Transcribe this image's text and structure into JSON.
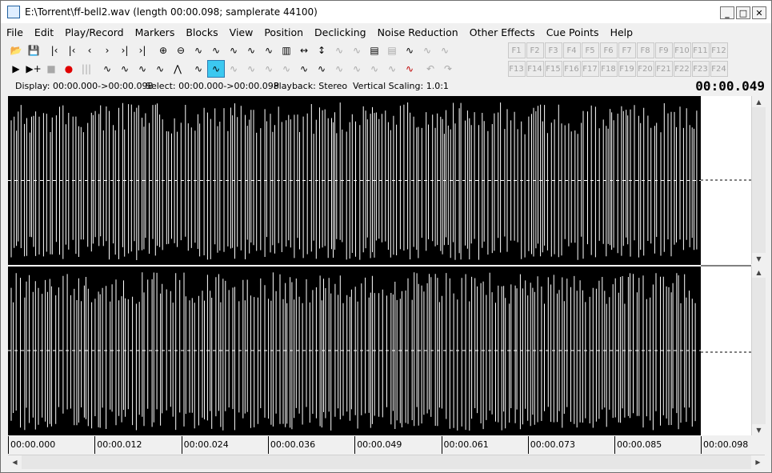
{
  "window": {
    "title": "E:\\Torrent\\ff-bell2.wav (length 00:00.098; samplerate 44100)"
  },
  "menu": [
    "File",
    "Edit",
    "Play/Record",
    "Markers",
    "Blocks",
    "View",
    "Position",
    "Declicking",
    "Noise Reduction",
    "Other Effects",
    "Cue Points",
    "Help"
  ],
  "toolbar": {
    "row1": [
      {
        "name": "open-icon",
        "glyph": "📂",
        "disabled": false
      },
      {
        "name": "save-icon",
        "glyph": "💾",
        "disabled": true
      },
      {
        "sep": true
      },
      {
        "name": "go-start-icon",
        "glyph": "|‹",
        "disabled": false
      },
      {
        "name": "marker-prev-icon",
        "glyph": "|‹",
        "disabled": false
      },
      {
        "name": "step-back-icon",
        "glyph": "‹",
        "disabled": false
      },
      {
        "name": "step-forward-icon",
        "glyph": "›",
        "disabled": false
      },
      {
        "name": "marker-next-icon",
        "glyph": "›|",
        "disabled": false
      },
      {
        "name": "go-end-icon",
        "glyph": "›|",
        "disabled": false
      },
      {
        "sep": true
      },
      {
        "name": "zoom-in-icon",
        "glyph": "⊕",
        "disabled": false
      },
      {
        "name": "zoom-out-icon",
        "glyph": "⊖",
        "disabled": false
      },
      {
        "name": "zoom-wave-icon",
        "glyph": "∿",
        "disabled": false
      },
      {
        "name": "wave-view-icon",
        "glyph": "∿",
        "disabled": false
      },
      {
        "name": "wave-marker-icon",
        "glyph": "∿",
        "disabled": false
      },
      {
        "name": "wave-edit-icon",
        "glyph": "∿",
        "disabled": false
      },
      {
        "name": "wave-peak-icon",
        "glyph": "∿",
        "disabled": false
      },
      {
        "name": "spectrum-icon",
        "glyph": "▥",
        "disabled": false
      },
      {
        "name": "horizontal-span-icon",
        "glyph": "↔",
        "disabled": false
      },
      {
        "name": "vertical-span-icon",
        "glyph": "↕",
        "disabled": false
      },
      {
        "name": "filter-a-icon",
        "glyph": "∿",
        "disabled": true
      },
      {
        "name": "filter-b-icon",
        "glyph": "∿",
        "disabled": true
      },
      {
        "name": "paste-wave-icon",
        "glyph": "▤",
        "disabled": false
      },
      {
        "name": "mix-wave-icon",
        "glyph": "▤",
        "disabled": true
      },
      {
        "name": "wave-add-icon",
        "glyph": "∿",
        "disabled": false
      },
      {
        "name": "wave-gray-a-icon",
        "glyph": "∿",
        "disabled": true
      },
      {
        "name": "wave-gray-b-icon",
        "glyph": "∿",
        "disabled": true
      }
    ],
    "row2": [
      {
        "name": "play-icon",
        "glyph": "▶",
        "disabled": false
      },
      {
        "name": "play-plus-icon",
        "glyph": "▶+",
        "disabled": false
      },
      {
        "name": "stop-icon",
        "glyph": "■",
        "disabled": true
      },
      {
        "name": "record-icon",
        "glyph": "●",
        "disabled": false,
        "color": "#e00000"
      },
      {
        "name": "level-meter-icon",
        "glyph": "|||",
        "disabled": true
      },
      {
        "sep": true
      },
      {
        "name": "fade-in-icon",
        "glyph": "∿",
        "disabled": false
      },
      {
        "name": "fade-out-icon",
        "glyph": "∿",
        "disabled": false
      },
      {
        "name": "amplify-icon",
        "glyph": "∿",
        "disabled": false
      },
      {
        "name": "normalize-icon",
        "glyph": "∿",
        "disabled": false
      },
      {
        "name": "peak-icon",
        "glyph": "⋀",
        "disabled": false
      },
      {
        "sep": true
      },
      {
        "name": "declick-icon",
        "glyph": "∿",
        "disabled": false
      },
      {
        "name": "declick-active-icon",
        "glyph": "∿",
        "disabled": false,
        "active": true
      },
      {
        "name": "dehiss-icon",
        "glyph": "∿",
        "disabled": true
      },
      {
        "name": "noise-gate-icon",
        "glyph": "∿",
        "disabled": true
      },
      {
        "name": "noise-profile-icon",
        "glyph": "∿",
        "disabled": true
      },
      {
        "name": "noise-filter-icon",
        "glyph": "∿",
        "disabled": true
      },
      {
        "name": "analyse-icon",
        "glyph": "∿",
        "disabled": false
      },
      {
        "name": "spectral-icon",
        "glyph": "∿",
        "disabled": false
      },
      {
        "name": "ramp-a-icon",
        "glyph": "∿",
        "disabled": true
      },
      {
        "name": "ramp-b-icon",
        "glyph": "∿",
        "disabled": true
      },
      {
        "name": "ramp-c-icon",
        "glyph": "∿",
        "disabled": true
      },
      {
        "name": "ramp-d-icon",
        "glyph": "∿",
        "disabled": true
      },
      {
        "name": "mark-click-icon",
        "glyph": "∿",
        "disabled": false,
        "color": "#c00000"
      },
      {
        "sep": true
      },
      {
        "name": "undo-icon",
        "glyph": "↶",
        "disabled": true
      },
      {
        "name": "redo-icon",
        "glyph": "↷",
        "disabled": true
      }
    ],
    "fkeys_row1": [
      "F1",
      "F2",
      "F3",
      "F4",
      "F5",
      "F6",
      "F7",
      "F8",
      "F9",
      "F10",
      "F11",
      "F12"
    ],
    "fkeys_row2": [
      "F13",
      "F14",
      "F15",
      "F16",
      "F17",
      "F18",
      "F19",
      "F20",
      "F21",
      "F22",
      "F23",
      "F24"
    ]
  },
  "status": {
    "display": "Display: 00:00.000->00:00.098",
    "select": "Select: 00:00.000->00:00.098",
    "playback": "Playback: Stereo",
    "scaling": "Vertical Scaling: 1.0:1",
    "time": "00:00.049"
  },
  "timeline": {
    "ticks": [
      "00:00.000",
      "00:00.012",
      "00:00.024",
      "00:00.036",
      "00:00.049",
      "00:00.061",
      "00:00.073",
      "00:00.085"
    ],
    "end": "00:00.098"
  },
  "colors": {
    "wave_bg": "#000000",
    "wave_fg": "#ffffff",
    "active_tool": "#3cc8f0",
    "record": "#e00000"
  }
}
